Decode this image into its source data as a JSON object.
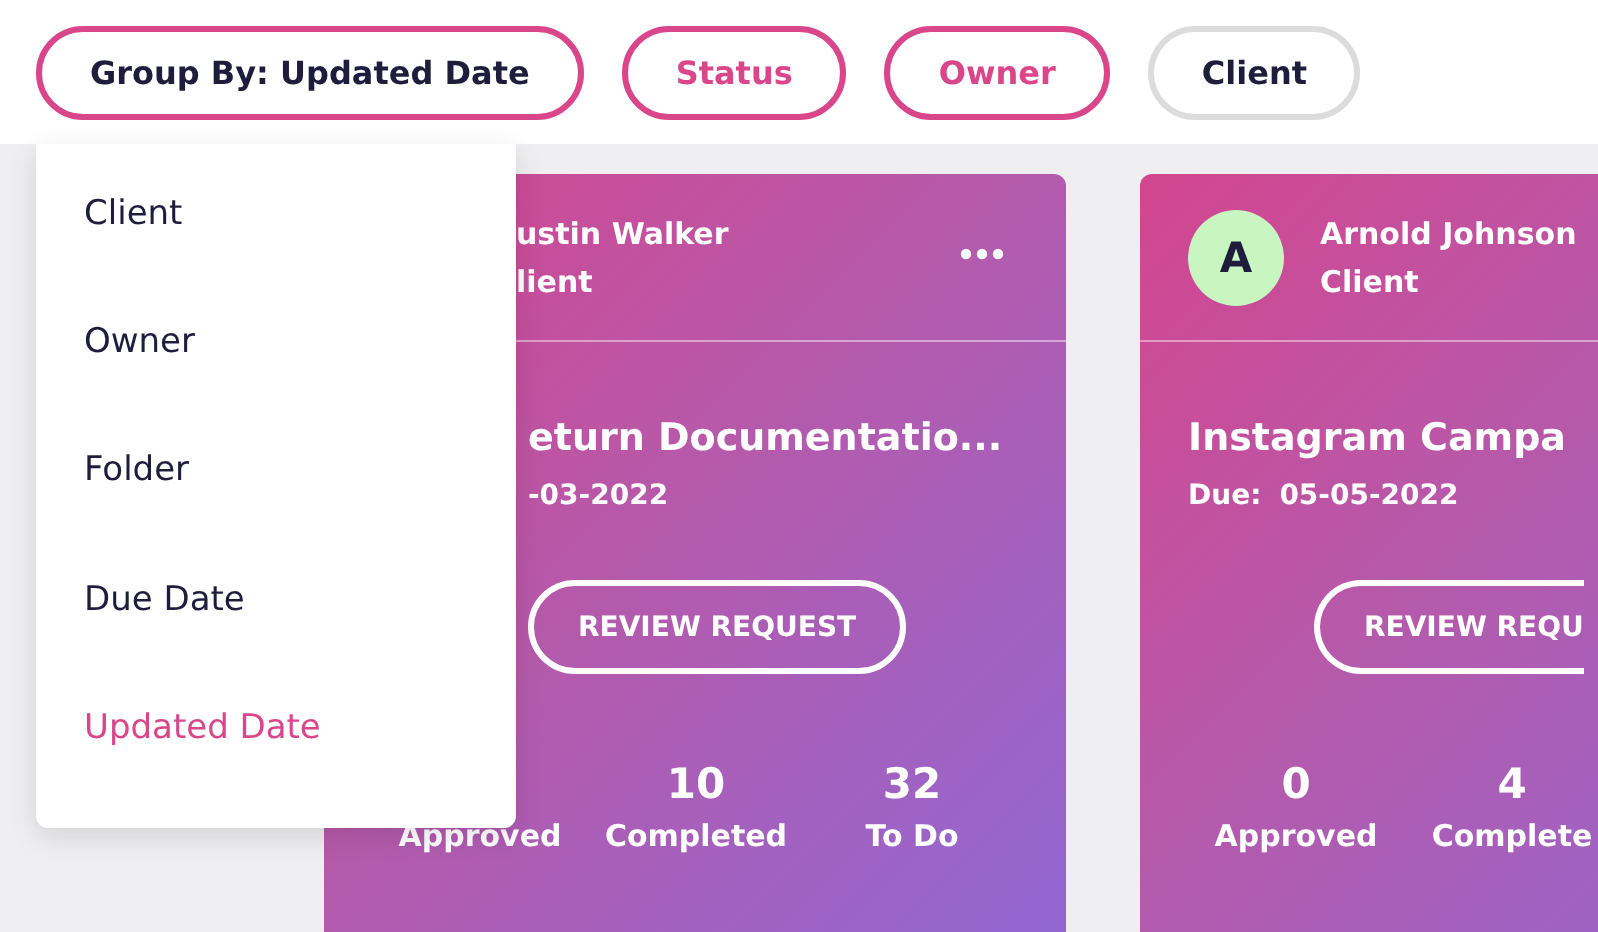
{
  "filter_bar": {
    "chips": [
      {
        "label": "Group By: Updated Date",
        "kind": "group",
        "active": true
      },
      {
        "label": "Status",
        "kind": "filter",
        "active": true
      },
      {
        "label": "Owner",
        "kind": "filter",
        "active": true
      },
      {
        "label": "Client",
        "kind": "filter",
        "active": false
      }
    ]
  },
  "group_menu": {
    "items": [
      {
        "label": "Client",
        "selected": false
      },
      {
        "label": "Owner",
        "selected": false
      },
      {
        "label": "Folder",
        "selected": false
      },
      {
        "label": "Due Date",
        "selected": false
      },
      {
        "label": "Updated Date",
        "selected": true
      }
    ]
  },
  "cards": [
    {
      "owner_name": "ustin Walker",
      "owner_role": "lient",
      "more_menu": true,
      "title": "eturn Documentatio...",
      "due_date": "-03-2022",
      "button": "REVIEW REQUEST",
      "stats": [
        {
          "label": "Approved"
        },
        {
          "value": "10",
          "label": "Completed"
        },
        {
          "value": "32",
          "label": "To Do"
        }
      ]
    },
    {
      "avatar": "A",
      "owner_name": "Arnold Johnson",
      "owner_role": "Client",
      "title": "Instagram Campa",
      "due_label": "Due:",
      "due_date": "05-05-2022",
      "button": "REVIEW REQU",
      "stats": [
        {
          "value": "0",
          "label": "Approved"
        },
        {
          "value": "4",
          "label": "Complete"
        }
      ]
    }
  ]
}
